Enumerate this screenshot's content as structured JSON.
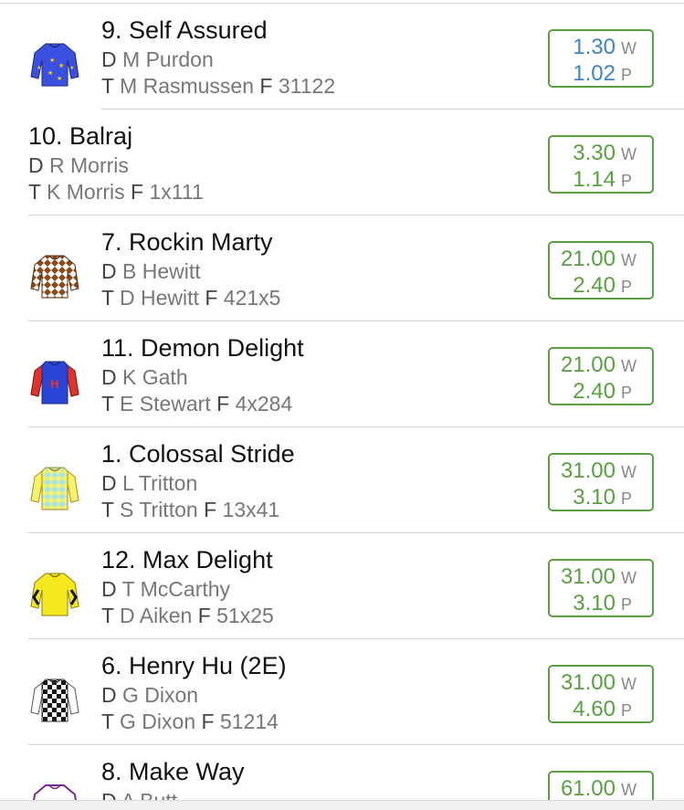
{
  "runners": [
    {
      "name": "9. Self Assured",
      "driver": "M Purdon",
      "trainer": "M Rasmussen",
      "form": "31122",
      "win": "1.30",
      "place": "1.02",
      "silk": "silk-blue-stars",
      "colors": [
        "#3b4fe0",
        "#f6d000"
      ]
    },
    {
      "name": "10. Balraj",
      "driver": "R Morris",
      "trainer": "K Morris",
      "form": "1x111",
      "win": "3.30",
      "place": "1.14",
      "silk": "none"
    },
    {
      "name": "7. Rockin Marty",
      "driver": "B Hewitt",
      "trainer": "D Hewitt",
      "form": "421x5",
      "win": "21.00",
      "place": "2.40",
      "silk": "silk-brown-diamonds",
      "colors": [
        "#8a4a1c",
        "#ffffff"
      ]
    },
    {
      "name": "11. Demon Delight",
      "driver": "K Gath",
      "trainer": "E Stewart",
      "form": "4x284",
      "win": "21.00",
      "place": "2.40",
      "silk": "silk-blue-red-sleeves-h",
      "colors": [
        "#2b46d6",
        "#e03428"
      ]
    },
    {
      "name": "1. Colossal Stride",
      "driver": "L Tritton",
      "trainer": "S Tritton",
      "form": "13x41",
      "win": "31.00",
      "place": "3.10",
      "silk": "silk-yellow-cyan-check",
      "colors": [
        "#f7f06a",
        "#a8e3e6"
      ]
    },
    {
      "name": "12. Max Delight",
      "driver": "T McCarthy",
      "trainer": "D Aiken",
      "form": "51x25",
      "win": "31.00",
      "place": "3.10",
      "silk": "silk-yellow-chevrons",
      "colors": [
        "#f5e81e",
        "#111111"
      ]
    },
    {
      "name": "6. Henry Hu (2E)",
      "driver": "G Dixon",
      "trainer": "G Dixon",
      "form": "51214",
      "win": "31.00",
      "place": "4.60",
      "silk": "silk-black-white-check",
      "colors": [
        "#111111",
        "#ffffff"
      ]
    },
    {
      "name": "8. Make Way",
      "driver": "A Butt",
      "trainer": "",
      "form": "",
      "win": "61.00",
      "place": "",
      "silk": "silk-purple-partial",
      "colors": [
        "#7b2a8c",
        "#ffffff"
      ]
    }
  ],
  "labels": {
    "driver": "D",
    "trainer": "T",
    "form": "F",
    "win": "W",
    "place": "P"
  }
}
